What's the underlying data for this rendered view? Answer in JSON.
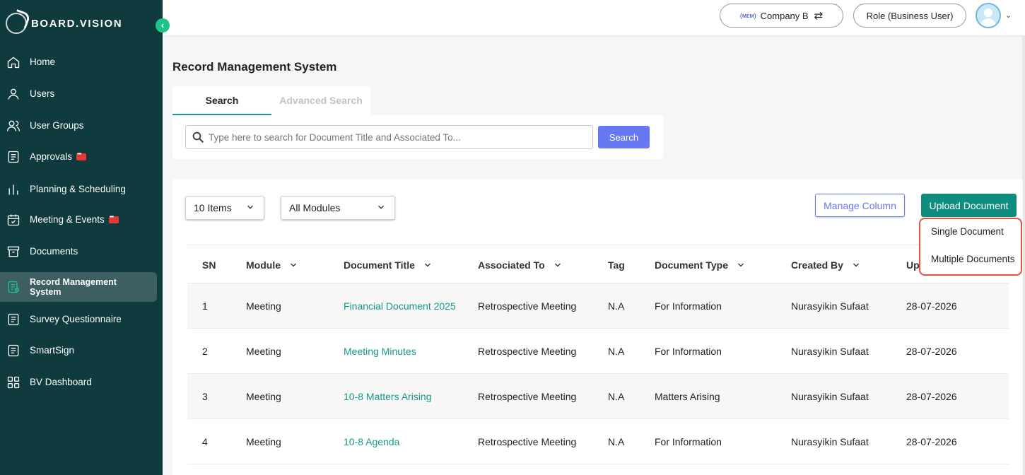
{
  "brand": {
    "name": "BOARD.VISION"
  },
  "sidebar": {
    "items": [
      {
        "label": "Home",
        "icon": "home-icon"
      },
      {
        "label": "Users",
        "icon": "user-icon"
      },
      {
        "label": "User Groups",
        "icon": "users-icon"
      },
      {
        "label": "Approvals",
        "icon": "approvals-icon",
        "badge": true
      },
      {
        "label": "Planning & Scheduling",
        "icon": "bar-chart-icon"
      },
      {
        "label": "Meeting & Events",
        "icon": "calendar-check-icon",
        "badge": true
      },
      {
        "label": "Documents",
        "icon": "archive-icon"
      },
      {
        "label": "Record Management System",
        "icon": "record-icon",
        "active": true
      },
      {
        "label": "Survey Questionnaire",
        "icon": "survey-icon"
      },
      {
        "label": "SmartSign",
        "icon": "smartsign-icon"
      },
      {
        "label": "BV Dashboard",
        "icon": "dashboard-icon"
      }
    ]
  },
  "header": {
    "company": "Company B",
    "company_logo_text": "(ᴍᴇᴍ)",
    "role": "Role (Business User)"
  },
  "page": {
    "title": "Record Management System"
  },
  "tabs": {
    "search": "Search",
    "advanced": "Advanced Search"
  },
  "search": {
    "placeholder": "Type here to search for Document Title and Associated To...",
    "button": "Search"
  },
  "toolbar": {
    "items_select": "10 Items",
    "modules_select": "All Modules",
    "manage_column": "Manage Column",
    "upload_document": "Upload Document"
  },
  "upload_menu": {
    "single": "Single Document",
    "multiple": "Multiple Documents"
  },
  "table": {
    "headers": {
      "sn": "SN",
      "module": "Module",
      "title": "Document Title",
      "associated": "Associated To",
      "tag": "Tag",
      "type": "Document Type",
      "created_by": "Created By",
      "updated": "Up"
    },
    "rows": [
      {
        "sn": "1",
        "module": "Meeting",
        "title": "Financial Document 2025",
        "associated": "Retrospective Meeting",
        "tag": "N.A",
        "type": "For Information",
        "created_by": "Nurasyikin Sufaat",
        "date": "28-07-2026"
      },
      {
        "sn": "2",
        "module": "Meeting",
        "title": "Meeting Minutes",
        "associated": "Retrospective Meeting",
        "tag": "N.A",
        "type": "For Information",
        "created_by": "Nurasyikin Sufaat",
        "date": "28-07-2026"
      },
      {
        "sn": "3",
        "module": "Meeting",
        "title": "10-8 Matters Arising",
        "associated": "Retrospective Meeting",
        "tag": "N.A",
        "type": "Matters Arising",
        "created_by": "Nurasyikin Sufaat",
        "date": "28-07-2026"
      },
      {
        "sn": "4",
        "module": "Meeting",
        "title": "10-8 Agenda",
        "associated": "Retrospective Meeting",
        "tag": "N.A",
        "type": "For Information",
        "created_by": "Nurasyikin Sufaat",
        "date": "28-07-2026"
      }
    ]
  },
  "colors": {
    "sidebar_bg": "#0f3a3e",
    "accent_teal": "#0f8e80",
    "accent_blue": "#6679f2",
    "highlight_red": "#e05540"
  }
}
